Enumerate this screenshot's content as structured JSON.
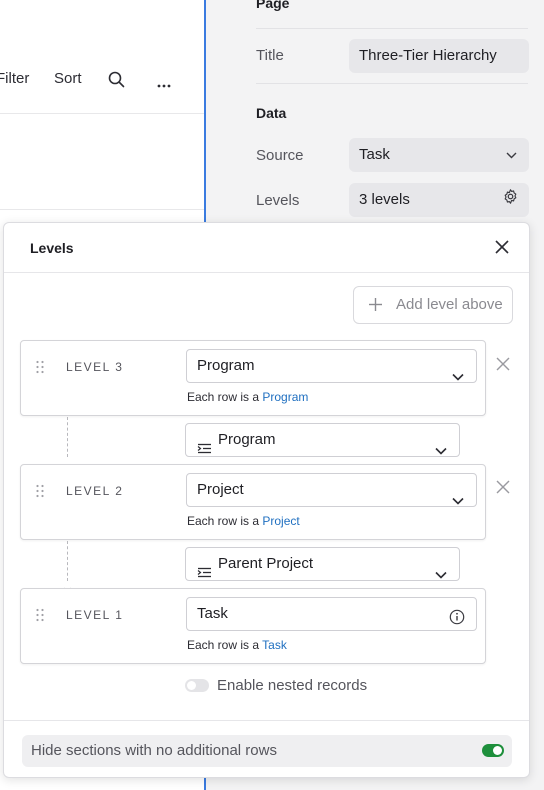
{
  "toolbar": {
    "filter_label": "Filter",
    "sort_label": "Sort"
  },
  "settings": {
    "page_heading": "Page",
    "title_label": "Title",
    "title_value": "Three-Tier Hierarchy",
    "data_heading": "Data",
    "source_label": "Source",
    "source_value": "Task",
    "levels_label": "Levels",
    "levels_value": "3 levels"
  },
  "modal": {
    "title": "Levels",
    "add_level_label": "Add level above",
    "each_row_prefix": "Each row is a",
    "levels": [
      {
        "label": "LEVEL 3",
        "value": "Program",
        "link": "Program",
        "removable": true
      },
      {
        "label": "LEVEL 2",
        "value": "Project",
        "link": "Project",
        "removable": true
      },
      {
        "label": "LEVEL 1",
        "value": "Task",
        "link": "Task",
        "removable": false
      }
    ],
    "links": [
      "Program",
      "Parent Project"
    ],
    "nested_label": "Enable nested records",
    "nested_enabled": false,
    "hide_sections_label": "Hide sections with no additional rows",
    "hide_sections_enabled": true
  },
  "colors": {
    "accent_blue": "#3a7be0",
    "link": "#1f6fc0",
    "toggle_on": "#1e8f3c"
  },
  "icons": [
    "search-icon",
    "more-icon",
    "chevron-down-icon",
    "gear-icon",
    "close-icon",
    "plus-icon",
    "grip-icon",
    "info-icon",
    "relation-icon"
  ]
}
